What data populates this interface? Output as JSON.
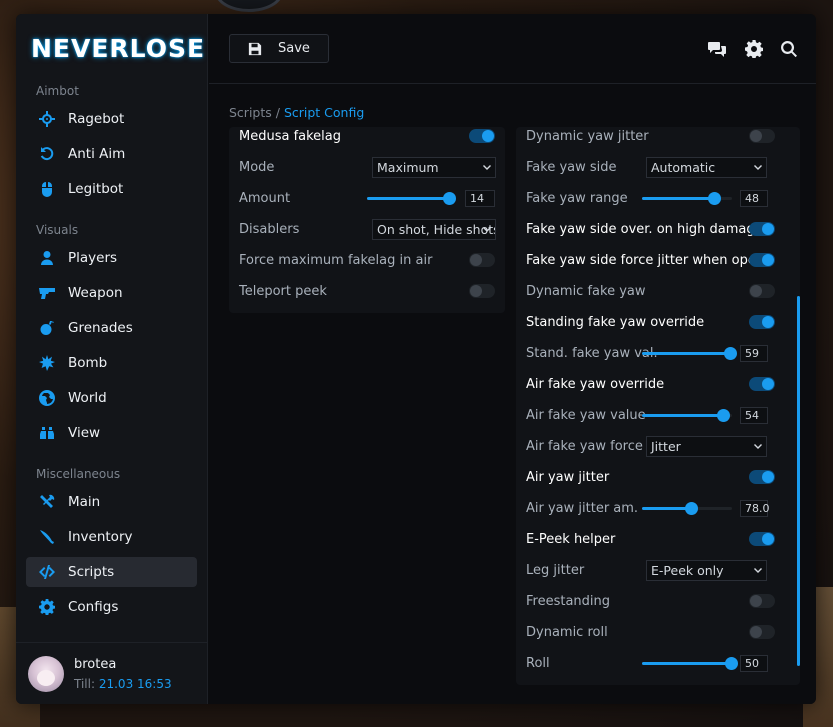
{
  "brand": "NEVERLOSE",
  "sidebar": {
    "sections": [
      {
        "label": "Aimbot",
        "items": [
          {
            "label": "Ragebot",
            "icon": "crosshair-icon"
          },
          {
            "label": "Anti Aim",
            "icon": "rotate-icon"
          },
          {
            "label": "Legitbot",
            "icon": "mouse-icon"
          }
        ]
      },
      {
        "label": "Visuals",
        "items": [
          {
            "label": "Players",
            "icon": "user-icon"
          },
          {
            "label": "Weapon",
            "icon": "gun-icon"
          },
          {
            "label": "Grenades",
            "icon": "bomb-icon"
          },
          {
            "label": "Bomb",
            "icon": "burst-icon"
          },
          {
            "label": "World",
            "icon": "globe-icon"
          },
          {
            "label": "View",
            "icon": "binoculars-icon"
          }
        ]
      },
      {
        "label": "Miscellaneous",
        "items": [
          {
            "label": "Main",
            "icon": "tools-icon"
          },
          {
            "label": "Inventory",
            "icon": "knife-icon"
          },
          {
            "label": "Scripts",
            "icon": "code-icon",
            "active": true
          },
          {
            "label": "Configs",
            "icon": "gear-icon"
          }
        ]
      }
    ],
    "user": {
      "name": "brotea",
      "till_label": "Till:",
      "till_value": "21.03 16:53"
    }
  },
  "toolbar": {
    "save_label": "Save"
  },
  "breadcrumb": {
    "parent": "Scripts",
    "separator": " / ",
    "current": "Script Config"
  },
  "left_panel": {
    "rows": [
      {
        "label": "Medusa fakelag",
        "type": "toggle",
        "on": true
      },
      {
        "label": "Mode",
        "type": "select",
        "value": "Maximum"
      },
      {
        "label": "Amount",
        "type": "slider",
        "value": "14",
        "fraction": 0.93
      },
      {
        "label": "Disablers",
        "type": "select",
        "value": "On shot, Hide shots"
      },
      {
        "label": "Force maximum fakelag in air",
        "type": "toggle",
        "on": false
      },
      {
        "label": "Teleport peek",
        "type": "toggle",
        "on": false
      }
    ]
  },
  "right_panel": {
    "rows": [
      {
        "label": "Dynamic yaw jitter",
        "type": "toggle",
        "on": false
      },
      {
        "label": "Fake yaw side",
        "type": "select",
        "value": "Automatic"
      },
      {
        "label": "Fake yaw range",
        "type": "slider",
        "value": "48",
        "fraction": 0.8
      },
      {
        "label": "Fake yaw side over. on high damage",
        "type": "toggle",
        "on": true
      },
      {
        "label": "Fake yaw side force jitter when open",
        "type": "toggle",
        "on": true
      },
      {
        "label": "Dynamic fake yaw",
        "type": "toggle",
        "on": false
      },
      {
        "label": "Standing fake yaw override",
        "type": "toggle",
        "on": true
      },
      {
        "label": "Stand. fake yaw val.",
        "type": "slider",
        "value": "59",
        "fraction": 0.98
      },
      {
        "label": "Air fake yaw override",
        "type": "toggle",
        "on": true
      },
      {
        "label": "Air fake yaw value",
        "type": "slider",
        "value": "54",
        "fraction": 0.9
      },
      {
        "label": "Air fake yaw force side",
        "type": "select",
        "value": "Jitter"
      },
      {
        "label": "Air yaw jitter",
        "type": "toggle",
        "on": true
      },
      {
        "label": "Air yaw jitter am.",
        "type": "slider",
        "value": "78.0",
        "fraction": 0.54
      },
      {
        "label": "E-Peek helper",
        "type": "toggle",
        "on": true
      },
      {
        "label": "Leg jitter",
        "type": "select",
        "value": "E-Peek only"
      },
      {
        "label": "Freestanding",
        "type": "toggle",
        "on": false
      },
      {
        "label": "Dynamic roll",
        "type": "toggle",
        "on": false
      },
      {
        "label": "Roll",
        "type": "slider",
        "value": "50",
        "fraction": 0.99
      }
    ]
  },
  "colors": {
    "accent": "#1a9cf0",
    "bg": "#0b0c0f",
    "panel": "#111317"
  }
}
